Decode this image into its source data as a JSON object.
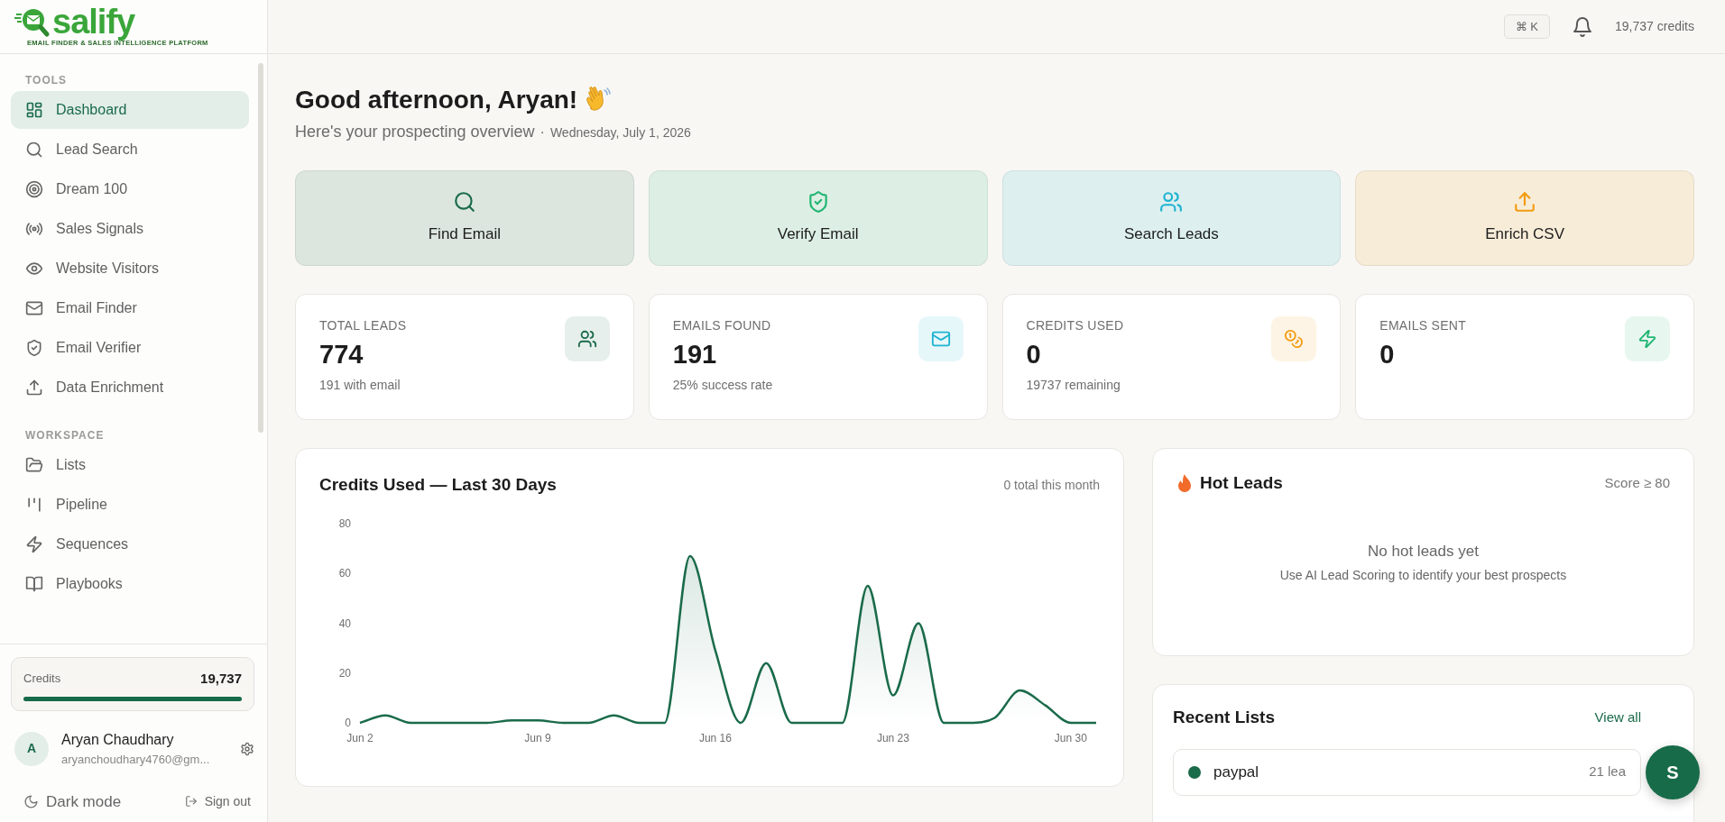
{
  "logo": {
    "name": "salify",
    "tagline": "EMAIL FINDER & SALES INTELLIGENCE PLATFORM"
  },
  "sidebar": {
    "sections": [
      {
        "title": "TOOLS",
        "items": [
          {
            "label": "Dashboard",
            "selected": true
          },
          {
            "label": "Lead Search",
            "selected": false
          },
          {
            "label": "Dream 100",
            "selected": false
          },
          {
            "label": "Sales Signals",
            "selected": false
          },
          {
            "label": "Website Visitors",
            "selected": false
          },
          {
            "label": "Email Finder",
            "selected": false
          },
          {
            "label": "Email Verifier",
            "selected": false
          },
          {
            "label": "Data Enrichment",
            "selected": false
          }
        ]
      },
      {
        "title": "WORKSPACE",
        "items": [
          {
            "label": "Lists",
            "selected": false
          },
          {
            "label": "Pipeline",
            "selected": false
          },
          {
            "label": "Sequences",
            "selected": false
          },
          {
            "label": "Playbooks",
            "selected": false
          }
        ]
      }
    ],
    "credits": {
      "label": "Credits",
      "value": "19,737",
      "level": 1
    },
    "user": {
      "initial": "A",
      "name": "Aryan Chaudhary",
      "email": "aryanchoudhary4760@gm..."
    },
    "footer": {
      "dark_mode": "Dark mode",
      "sign_out": "Sign out"
    }
  },
  "header": {
    "shortcut": "⌘ K",
    "credits": "19,737 credits"
  },
  "greeting": {
    "title": "Good afternoon, Aryan!",
    "subtitle": "Here's your prospecting overview",
    "separator": "·",
    "date": "Wednesday, July 1, 2026"
  },
  "quick_actions": [
    {
      "label": "Find Email",
      "color": "#1a6b4a"
    },
    {
      "label": "Verify Email",
      "color": "#22b573"
    },
    {
      "label": "Search Leads",
      "color": "#1fb3d1"
    },
    {
      "label": "Enrich CSV",
      "color": "#f39c12"
    }
  ],
  "stats": [
    {
      "label": "TOTAL LEADS",
      "value": "774",
      "note": "191 with email",
      "color": "#1a6b4a"
    },
    {
      "label": "EMAILS FOUND",
      "value": "191",
      "note": "25% success rate",
      "color": "#1fb3d1"
    },
    {
      "label": "CREDITS USED",
      "value": "0",
      "note": "19737 remaining",
      "color": "#f39c12"
    },
    {
      "label": "EMAILS SENT",
      "value": "0",
      "color": "#22b573"
    }
  ],
  "credits_chart": {
    "title": "Credits Used — Last 30 Days",
    "summary": "0 total this month",
    "chart_data": {
      "type": "area",
      "categories": [
        "Jun 2",
        null,
        null,
        null,
        null,
        null,
        null,
        "Jun 9",
        null,
        null,
        null,
        null,
        null,
        null,
        "Jun 16",
        null,
        null,
        null,
        null,
        null,
        null,
        "Jun 23",
        null,
        null,
        null,
        null,
        null,
        null,
        "Jun 30",
        null
      ],
      "series": [
        {
          "color": "#1a6b4a",
          "values": [
            0,
            3,
            0,
            0,
            0,
            0,
            1,
            1,
            0,
            0,
            3,
            0,
            0,
            67,
            29,
            0,
            24,
            0,
            0,
            0,
            55,
            11,
            40,
            0,
            0,
            2,
            13,
            7,
            0,
            0
          ]
        }
      ],
      "ylim": [
        0,
        80
      ],
      "yticks": [
        0,
        20,
        40,
        60,
        80
      ]
    }
  },
  "hot_leads": {
    "title": "Hot Leads",
    "filter": "Score ≥ 80",
    "empty_title": "No hot leads yet",
    "empty_text": "Use AI Lead Scoring to identify your best prospects"
  },
  "recent_lists": {
    "title": "Recent Lists",
    "link": "View all",
    "items": [
      {
        "name": "paypal",
        "count": "21 lea",
        "color": "#1a6b4a"
      }
    ]
  },
  "chat_button": {
    "label": "S"
  }
}
